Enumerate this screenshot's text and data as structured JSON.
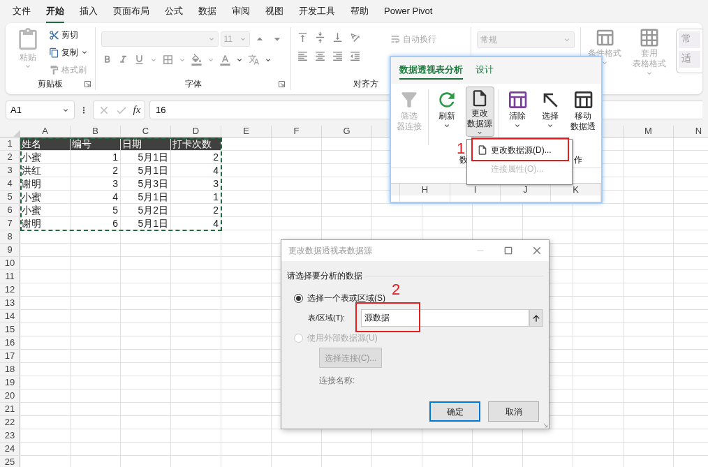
{
  "menu_tabs": [
    {
      "label": "文件",
      "selected": false
    },
    {
      "label": "开始",
      "selected": true
    },
    {
      "label": "插入",
      "selected": false
    },
    {
      "label": "页面布局",
      "selected": false
    },
    {
      "label": "公式",
      "selected": false
    },
    {
      "label": "数据",
      "selected": false
    },
    {
      "label": "审阅",
      "selected": false
    },
    {
      "label": "视图",
      "selected": false
    },
    {
      "label": "开发工具",
      "selected": false
    },
    {
      "label": "帮助",
      "selected": false
    },
    {
      "label": "Power Pivot",
      "selected": false
    }
  ],
  "ribbon": {
    "clipboard": {
      "paste": {
        "label": "粘贴",
        "disabled": true
      },
      "items": [
        {
          "kind": "cut",
          "label": "剪切",
          "disabled": false
        },
        {
          "kind": "copy",
          "label": "复制",
          "disabled": false
        },
        {
          "kind": "painter",
          "label": "格式刷",
          "disabled": true
        }
      ],
      "group_label": "剪贴板"
    },
    "font": {
      "size": "11",
      "group_label": "字体"
    },
    "alignment": {
      "group_label": "对齐方"
    },
    "wrap": {
      "label": "自动换行",
      "disabled": true
    },
    "number_format": {
      "value": "常规"
    },
    "styles": [
      {
        "kind": "conditional",
        "lines": [
          "条件格式"
        ],
        "disabled": true
      },
      {
        "kind": "table",
        "lines": [
          "套用",
          "表格格式"
        ],
        "disabled": true
      }
    ],
    "gallery": [
      "常",
      "适"
    ]
  },
  "formula_bar": {
    "name_box": "A1",
    "function_button": "fx",
    "value": "16"
  },
  "grid": {
    "columns_left": [
      "A",
      "B",
      "C",
      "D",
      "E",
      "F",
      "G"
    ],
    "columns_right": [
      "M",
      "N"
    ],
    "rows": [
      {
        "number": "1",
        "kind": "header",
        "cells": [
          "姓名",
          "编号",
          "日期",
          "打卡次数"
        ]
      },
      {
        "number": "2",
        "kind": "data",
        "cells": [
          "小蜜",
          "1",
          "5月1日",
          "2"
        ]
      },
      {
        "number": "3",
        "kind": "data",
        "cells": [
          "洪红",
          "2",
          "5月1日",
          "4"
        ]
      },
      {
        "number": "4",
        "kind": "data",
        "cells": [
          "谢明",
          "3",
          "5月3日",
          "3"
        ]
      },
      {
        "number": "5",
        "kind": "data",
        "cells": [
          "小蜜",
          "4",
          "5月1日",
          "1"
        ]
      },
      {
        "number": "6",
        "kind": "data",
        "cells": [
          "小蜜",
          "5",
          "5月2日",
          "2"
        ]
      },
      {
        "number": "7",
        "kind": "data",
        "cells": [
          "谢明",
          "6",
          "5月1日",
          "4"
        ]
      },
      {
        "number": "8"
      },
      {
        "number": "9"
      },
      {
        "number": "10"
      },
      {
        "number": "11"
      },
      {
        "number": "12"
      },
      {
        "number": "13"
      },
      {
        "number": "14"
      },
      {
        "number": "15"
      },
      {
        "number": "16"
      },
      {
        "number": "17"
      },
      {
        "number": "18"
      },
      {
        "number": "19"
      },
      {
        "number": "20"
      },
      {
        "number": "21"
      },
      {
        "number": "22"
      },
      {
        "number": "23"
      },
      {
        "number": "24"
      },
      {
        "number": "25"
      }
    ]
  },
  "popup": {
    "tabs": [
      {
        "label": "数据透视表分析",
        "selected": true
      },
      {
        "label": "设计",
        "selected": false
      }
    ],
    "buttons": [
      {
        "kind": "filter",
        "lines": [
          "筛选",
          "器连接"
        ],
        "disabled": true,
        "pressed": false,
        "caret": false
      },
      {
        "kind": "refresh",
        "lines": [
          "刷新"
        ],
        "disabled": false,
        "pressed": false,
        "caret": true
      },
      {
        "kind": "source",
        "lines": [
          "更改",
          "数据源"
        ],
        "disabled": false,
        "pressed": true,
        "caret": true
      },
      {
        "kind": "clear",
        "lines": [
          "清除"
        ],
        "disabled": false,
        "pressed": false,
        "caret": true
      },
      {
        "kind": "select",
        "lines": [
          "选择"
        ],
        "disabled": false,
        "pressed": false,
        "caret": true
      },
      {
        "kind": "move",
        "lines": [
          "移动",
          "数据透"
        ],
        "disabled": false,
        "pressed": false,
        "caret": false
      }
    ],
    "group_labels": [
      "数",
      "作"
    ],
    "menu": [
      {
        "label": "更改数据源(D)...",
        "disabled": false
      },
      {
        "label": "连接属性(O)...",
        "disabled": true
      }
    ],
    "columns": [
      "H",
      "I",
      "J",
      "K"
    ],
    "marker": "1"
  },
  "dialog": {
    "title": "更改数据透视表数据源",
    "section": "请选择要分析的数据",
    "options": [
      {
        "label": "选择一个表或区域(S)",
        "selected": true,
        "disabled": false
      },
      {
        "label": "使用外部数据源(U)",
        "selected": false,
        "disabled": true
      }
    ],
    "range_label": "表/区域(T):",
    "range_value": "源数据",
    "connect_button": "选择连接(C)...",
    "connection_name_label": "连接名称:",
    "ok": "确定",
    "cancel": "取消",
    "marker": "2"
  }
}
